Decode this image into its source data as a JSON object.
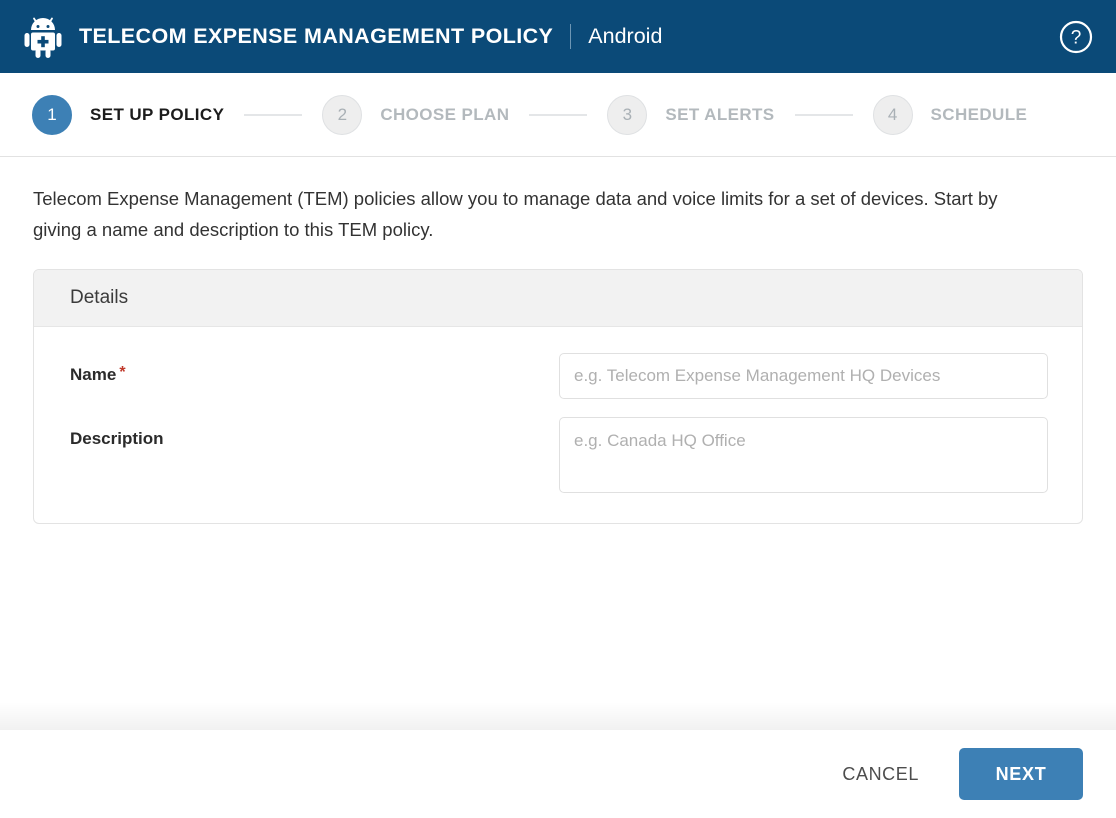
{
  "header": {
    "logo_icon": "android-robot-icon",
    "title": "TELECOM EXPENSE MANAGEMENT POLICY",
    "platform": "Android",
    "help_icon": "help-circle-icon",
    "background_color": "#0b4a78"
  },
  "stepper": {
    "steps": [
      {
        "number": "1",
        "label": "SET UP POLICY",
        "state": "active"
      },
      {
        "number": "2",
        "label": "CHOOSE PLAN",
        "state": "inactive"
      },
      {
        "number": "3",
        "label": "SET ALERTS",
        "state": "inactive"
      },
      {
        "number": "4",
        "label": "SCHEDULE",
        "state": "inactive"
      }
    ],
    "active_color": "#3d80b5",
    "inactive_color": "#b3b9bd"
  },
  "main": {
    "intro": "Telecom Expense Management (TEM) policies allow you to manage data and voice limits for a set of devices. Start by giving a name and description to this TEM policy.",
    "card": {
      "title": "Details",
      "fields": {
        "name": {
          "label": "Name",
          "required_marker": "*",
          "value": "",
          "placeholder": "e.g. Telecom Expense Management HQ Devices"
        },
        "description": {
          "label": "Description",
          "value": "",
          "placeholder": "e.g. Canada HQ Office"
        }
      },
      "required_color": "#c0392b"
    }
  },
  "footer": {
    "cancel_label": "CANCEL",
    "next_label": "NEXT",
    "next_color": "#3d80b5"
  }
}
